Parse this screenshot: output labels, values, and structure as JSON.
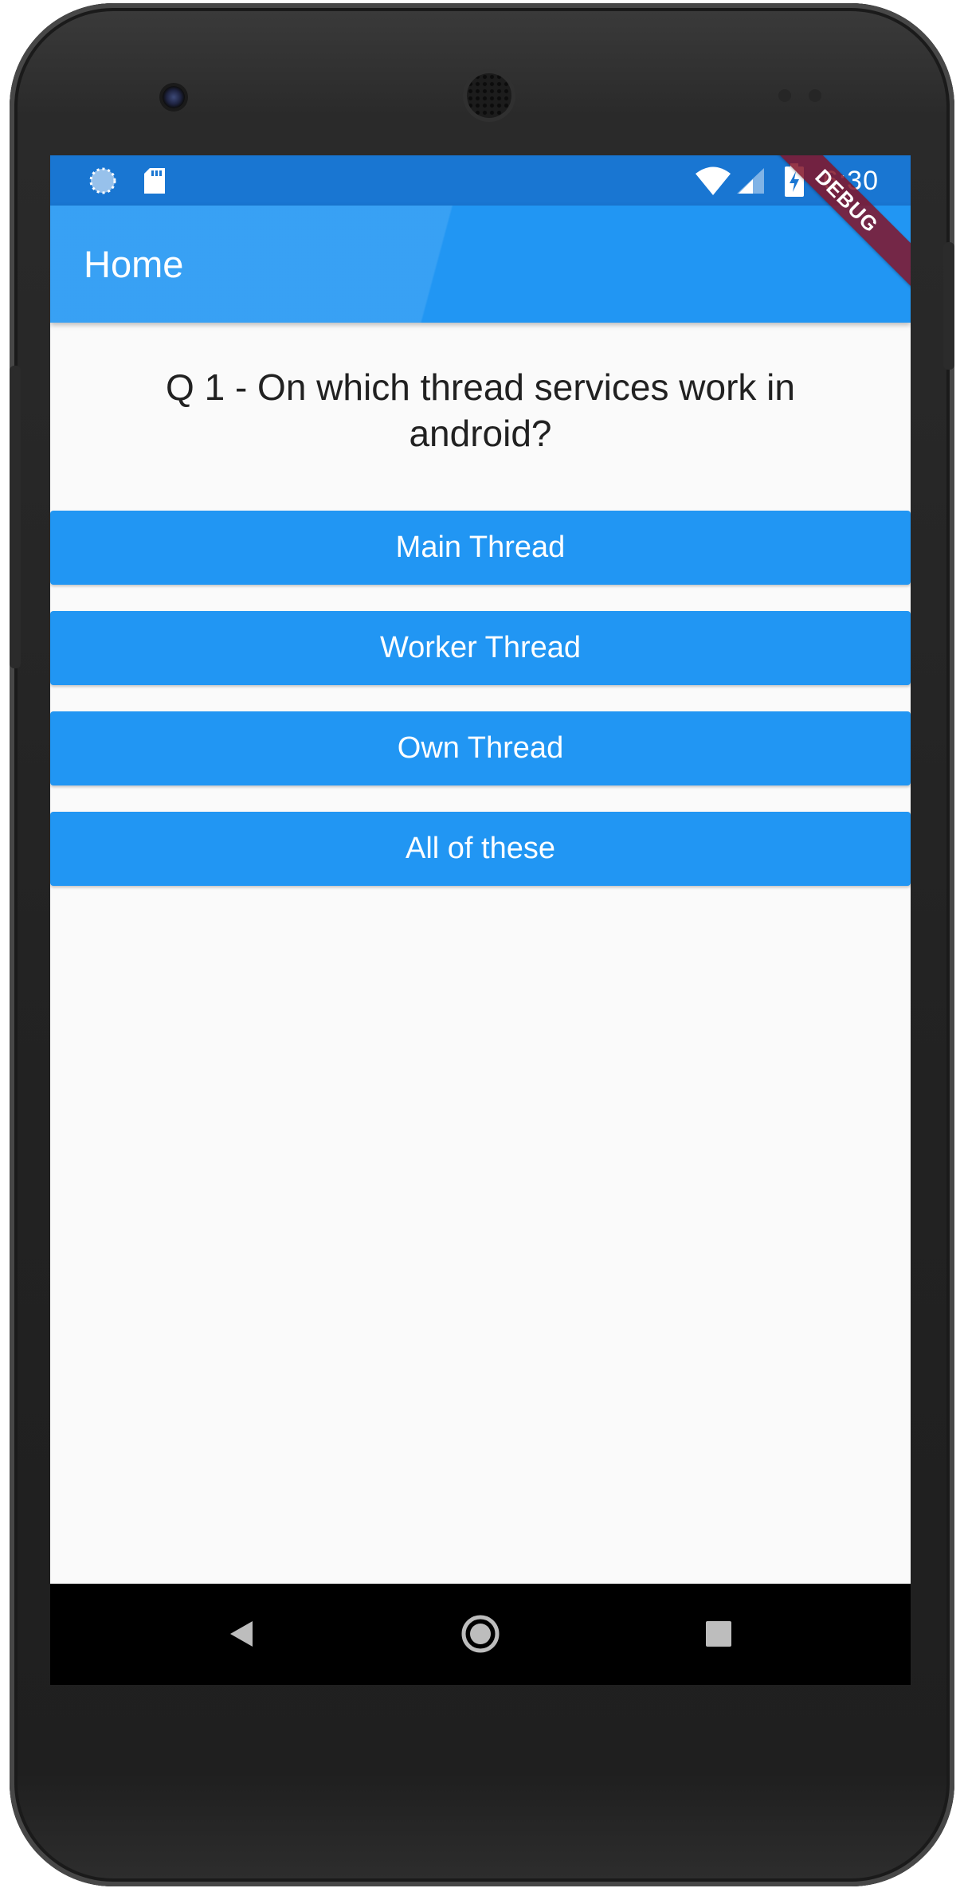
{
  "status_bar": {
    "time": "6:30",
    "icons": [
      "sync-icon",
      "sd-card-icon",
      "wifi-icon",
      "cell-signal-icon",
      "battery-charging-icon"
    ]
  },
  "debug_banner": "DEBUG",
  "app_bar": {
    "title": "Home"
  },
  "quiz": {
    "question": "Q 1 - On which thread services work in android?",
    "answers": [
      "Main Thread",
      "Worker Thread",
      "Own Thread",
      "All of these"
    ]
  },
  "nav_bar": {
    "icons": [
      "back-icon",
      "home-icon",
      "recents-icon"
    ]
  },
  "colors": {
    "primary": "#2196f3",
    "status_bar": "#1976d2",
    "background": "#fafafa",
    "question_text": "#212121",
    "debug_ribbon": "#821428"
  }
}
